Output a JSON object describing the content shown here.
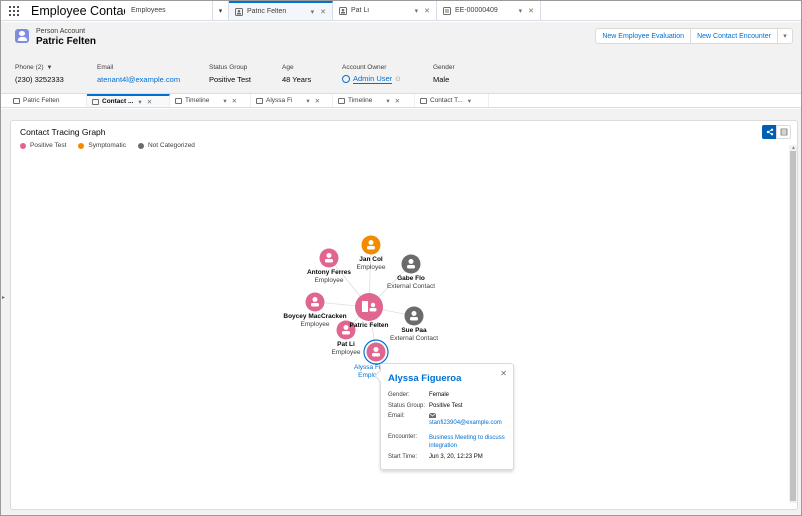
{
  "nav": {
    "app_name": "Employee Contact...",
    "tabs": [
      {
        "label": "Employees"
      },
      {
        "label": "Patric Felten"
      },
      {
        "label": "Pat Li"
      },
      {
        "label": "EE-00000409"
      }
    ]
  },
  "header": {
    "record_type": "Person Account",
    "record_name": "Patric Felten",
    "buttons": {
      "evaluation": "New Employee Evaluation",
      "encounter": "New Contact Encounter"
    },
    "fields": [
      {
        "label": "Phone (2)",
        "value": "(230) 3252333"
      },
      {
        "label": "Email",
        "value": "atenant4l@example.com"
      },
      {
        "label": "Status Group",
        "value": "Positive Test"
      },
      {
        "label": "Age",
        "value": "48 Years"
      },
      {
        "label": "Account Owner",
        "value": "Admin User"
      },
      {
        "label": "Gender",
        "value": "Male"
      }
    ]
  },
  "subtabs": [
    {
      "label": "Patric Felten"
    },
    {
      "label": "Contact ..."
    },
    {
      "label": "Timeline"
    },
    {
      "label": "Alyssa Fi"
    },
    {
      "label": "Timeline"
    },
    {
      "label": "Contact T..."
    }
  ],
  "card": {
    "title": "Contact Tracing Graph",
    "legend": [
      {
        "label": "Positive Test",
        "color": "#e0668f"
      },
      {
        "label": "Symptomatic",
        "color": "#f38b00"
      },
      {
        "label": "Not Categorized",
        "color": "#6b6b6b"
      }
    ]
  },
  "graph": {
    "center": {
      "name": "Patric Felten",
      "type": "",
      "color": "#e0668f"
    },
    "nodes": [
      {
        "name": "Jan Col",
        "type": "Employee",
        "color": "#f38b00"
      },
      {
        "name": "Gabe Flo",
        "type": "External Contact",
        "color": "#6b6b6b"
      },
      {
        "name": "Antony Ferres",
        "type": "Employee",
        "color": "#e0668f"
      },
      {
        "name": "Boycey MacCracken",
        "type": "Employee",
        "color": "#e0668f"
      },
      {
        "name": "Sue Paa",
        "type": "External Contact",
        "color": "#6b6b6b"
      },
      {
        "name": "Pat Li",
        "type": "Employee",
        "color": "#e0668f"
      },
      {
        "name": "Alyssa Fig",
        "type": "Employ",
        "color": "#e0668f"
      }
    ]
  },
  "popover": {
    "title": "Alyssa Figueroa",
    "rows": [
      {
        "key": "Gender:",
        "value": "Female"
      },
      {
        "key": "Status Group:",
        "value": "Positive Test"
      },
      {
        "key": "Email:",
        "value": "stanfi23904@example.com"
      },
      {
        "key": "Encounter:",
        "value": "Business Meeting to discuss integration"
      },
      {
        "key": "Start Time:",
        "value": "Jun 3, 20, 12:23 PM"
      }
    ]
  }
}
